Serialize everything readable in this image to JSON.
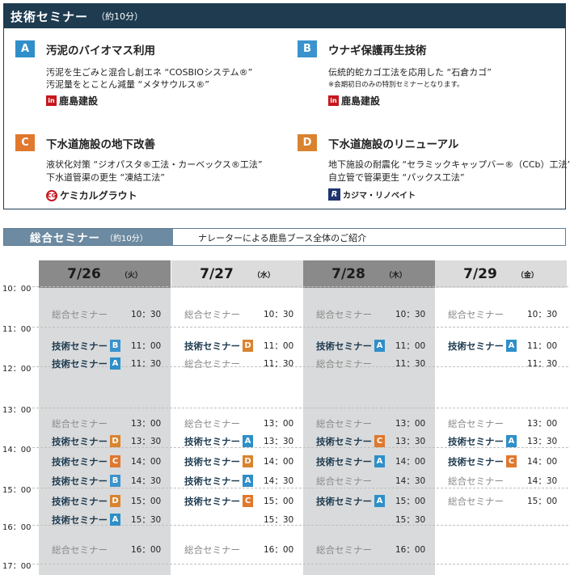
{
  "tech_panel": {
    "title": "技術セミナー",
    "duration": "（約10分）",
    "seminars": [
      {
        "badge": "A",
        "title": "汚泥のバイオマス利用",
        "lines": [
          "汚泥を生ごみと混合し創エネ “COSBIOシステム®”",
          "汚泥量をとことん減量 “メタサウルス®”"
        ],
        "note": "",
        "logo_mark": "in",
        "logo_text": "鹿島建設"
      },
      {
        "badge": "B",
        "title": "ウナギ保護再生技術",
        "lines": [
          "伝統的蛇カゴ工法を応用した “石倉カゴ”"
        ],
        "note": "※会期初日のみの特別セミナーとなります。",
        "logo_mark": "in",
        "logo_text": "鹿島建設"
      },
      {
        "badge": "C",
        "title": "下水道施設の地下改善",
        "lines": [
          "液状化対策 “ジオパスタ®工法・カーベックス®工法”",
          "下水道管渠の更生 “凍結工法”"
        ],
        "note": "",
        "logo_mark": "CG",
        "logo_text": "ケミカルグラウト"
      },
      {
        "badge": "D",
        "title": "下水道施設のリニューアル",
        "lines": [
          "地下施設の耐震化 “セラミックキャップバー®（CCb）工法”",
          "自立管で管渠更生 “パックス工法”"
        ],
        "note": "",
        "logo_mark": "R",
        "logo_text": "カジマ・リノベイト"
      }
    ]
  },
  "general_bar": {
    "title": "総合セミナー",
    "duration": "（約10分）",
    "description": "ナレーターによる鹿島ブース全体のご紹介"
  },
  "schedule": {
    "times": [
      "10：00",
      "11：00",
      "12：00",
      "13：00",
      "14：00",
      "15：00",
      "16：00",
      "17：00"
    ],
    "days": [
      {
        "date": "7/26",
        "dow": "（火）",
        "entries": [
          {
            "name": "総合セミナー",
            "badge": "",
            "time": "10：30"
          },
          {
            "name": "技術セミナー",
            "badge": "B",
            "time": "11：00"
          },
          {
            "name": "技術セミナー",
            "badge": "A",
            "time": "11：30"
          },
          {
            "name": "総合セミナー",
            "badge": "",
            "time": "13：00"
          },
          {
            "name": "技術セミナー",
            "badge": "D",
            "time": "13：30"
          },
          {
            "name": "技術セミナー",
            "badge": "C",
            "time": "14：00"
          },
          {
            "name": "技術セミナー",
            "badge": "B",
            "time": "14：30"
          },
          {
            "name": "技術セミナー",
            "badge": "D",
            "time": "15：00"
          },
          {
            "name": "技術セミナー",
            "badge": "A",
            "time": "15：30"
          },
          {
            "name": "総合セミナー",
            "badge": "",
            "time": "16：00"
          }
        ]
      },
      {
        "date": "7/27",
        "dow": "（水）",
        "entries": [
          {
            "name": "総合セミナー",
            "badge": "",
            "time": "10：30"
          },
          {
            "name": "技術セミナー",
            "badge": "D",
            "time": "11：00"
          },
          {
            "name": "総合セミナー",
            "badge": "",
            "time": "11：30"
          },
          {
            "name": "総合セミナー",
            "badge": "",
            "time": "13：00"
          },
          {
            "name": "技術セミナー",
            "badge": "A",
            "time": "13：30"
          },
          {
            "name": "技術セミナー",
            "badge": "D",
            "time": "14：00"
          },
          {
            "name": "技術セミナー",
            "badge": "A",
            "time": "14：30"
          },
          {
            "name": "技術セミナー",
            "badge": "C",
            "time": "15：00"
          },
          {
            "name": "",
            "badge": "",
            "time": "15：30"
          },
          {
            "name": "総合セミナー",
            "badge": "",
            "time": "16：00"
          }
        ]
      },
      {
        "date": "7/28",
        "dow": "（木）",
        "entries": [
          {
            "name": "総合セミナー",
            "badge": "",
            "time": "10：30"
          },
          {
            "name": "技術セミナー",
            "badge": "A",
            "time": "11：00"
          },
          {
            "name": "総合セミナー",
            "badge": "",
            "time": "11：30"
          },
          {
            "name": "総合セミナー",
            "badge": "",
            "time": "13：00"
          },
          {
            "name": "技術セミナー",
            "badge": "C",
            "time": "13：30"
          },
          {
            "name": "技術セミナー",
            "badge": "A",
            "time": "14：00"
          },
          {
            "name": "総合セミナー",
            "badge": "",
            "time": "14：30"
          },
          {
            "name": "技術セミナー",
            "badge": "A",
            "time": "15：00"
          },
          {
            "name": "",
            "badge": "",
            "time": "15：30"
          },
          {
            "name": "総合セミナー",
            "badge": "",
            "time": "16：00"
          }
        ]
      },
      {
        "date": "7/29",
        "dow": "（金）",
        "entries": [
          {
            "name": "総合セミナー",
            "badge": "",
            "time": "10：30"
          },
          {
            "name": "技術セミナー",
            "badge": "A",
            "time": "11：00"
          },
          {
            "name": "",
            "badge": "",
            "time": "11：30"
          },
          {
            "name": "総合セミナー",
            "badge": "",
            "time": "13：00"
          },
          {
            "name": "技術セミナー",
            "badge": "A",
            "time": "13：30"
          },
          {
            "name": "技術セミナー",
            "badge": "C",
            "time": "14：00"
          },
          {
            "name": "総合セミナー",
            "badge": "",
            "time": "14：30"
          },
          {
            "name": "総合セミナー",
            "badge": "",
            "time": "15：00"
          }
        ]
      }
    ]
  }
}
